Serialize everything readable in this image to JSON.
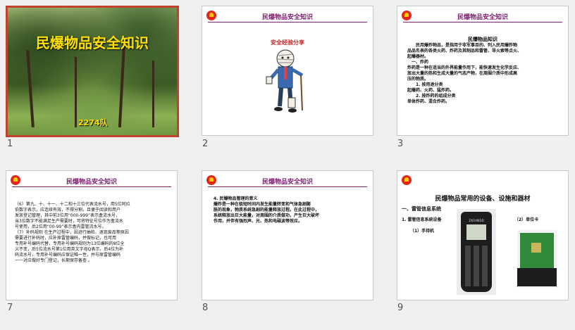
{
  "slides": [
    {
      "number": "1",
      "title": "民爆物品安全知识",
      "subtitle": "2274队",
      "selected": true
    },
    {
      "number": "2",
      "title": "民爆物品安全知识",
      "caption": "安全经验分享"
    },
    {
      "number": "3",
      "title": "民爆物品安全知识",
      "heading": "民爆物品知识",
      "lines": [
        "　　民用爆炸物品，是指用于非军事目的、列入民用爆炸物",
        "品品名表的各类火药、炸药及其制品和雷管、导火索等点火、",
        "起爆器材。",
        "　一、炸药",
        "炸药是一种在适当的外界能量作用下，能快速发生化学反应、",
        "放出大量的热和生成大量的气态产物，在周围介质中形成高",
        "压的物质。",
        "　　1. 按用途分类",
        "起爆药、火药、猛炸药。",
        "　　2. 按炸药的组成分类",
        "单体炸药、混合炸药。"
      ]
    },
    {
      "number": "7",
      "title": "民爆物品安全知识",
      "lines": [
        "（6）第九、十、十一、十二和十三位代表流水号，用5位阿拉",
        "伯数字表示，应连续有效，不得分割，且便于阅读和用户",
        "发放登记管理，其中前3位用“000-999”表示盒流水号，",
        "当3位数字不能满足生产需要时，可将特征号位作为盒流水",
        "号使用，后2位用“00-99”表示盒内雷管流水号。",
        "（7）补码规则  在生产过程中，因进行抽检、退现废品等原因",
        "需要进行补码时，应补原雷管编码，并做标记，也可用",
        "专用补号编码代替，专用补号编码规则为13位编码的8位全",
        "义不变，后5位流水号第1位用英文字母Q表示，后4位为补",
        "码流水号，专用补号编码应保证唯一性，并与原雷管编码",
        "一一对应做好专门登记，长期保存备查 。"
      ]
    },
    {
      "number": "8",
      "title": "民爆物品安全知识",
      "lines": [
        "4. 民爆物品管理的意义",
        "爆炸是一种在极短时间内发生能量转变和气体急剧膨",
        "胀的现象，物质系统急剧的能量释放过程。在此过程中，",
        "系统释放出巨大能量，对周围的介质做功，产生巨大破坏",
        "作用，并伴有强烈声、光、热和电磁波等效应。"
      ]
    },
    {
      "number": "9",
      "title": "民爆物品常用的设备、设施和器材",
      "lines": [
        "一、雷管信息系统",
        "1. 雷管信息系统设备",
        "（1）手持机",
        "（2）单位卡"
      ],
      "device_label": "ZXCHNIDD"
    }
  ],
  "colors": {
    "selected_border": "#c0442b",
    "title_purple": "#7a1f6e",
    "title_yellow": "#ffe100",
    "caption_red": "#c0282d"
  }
}
